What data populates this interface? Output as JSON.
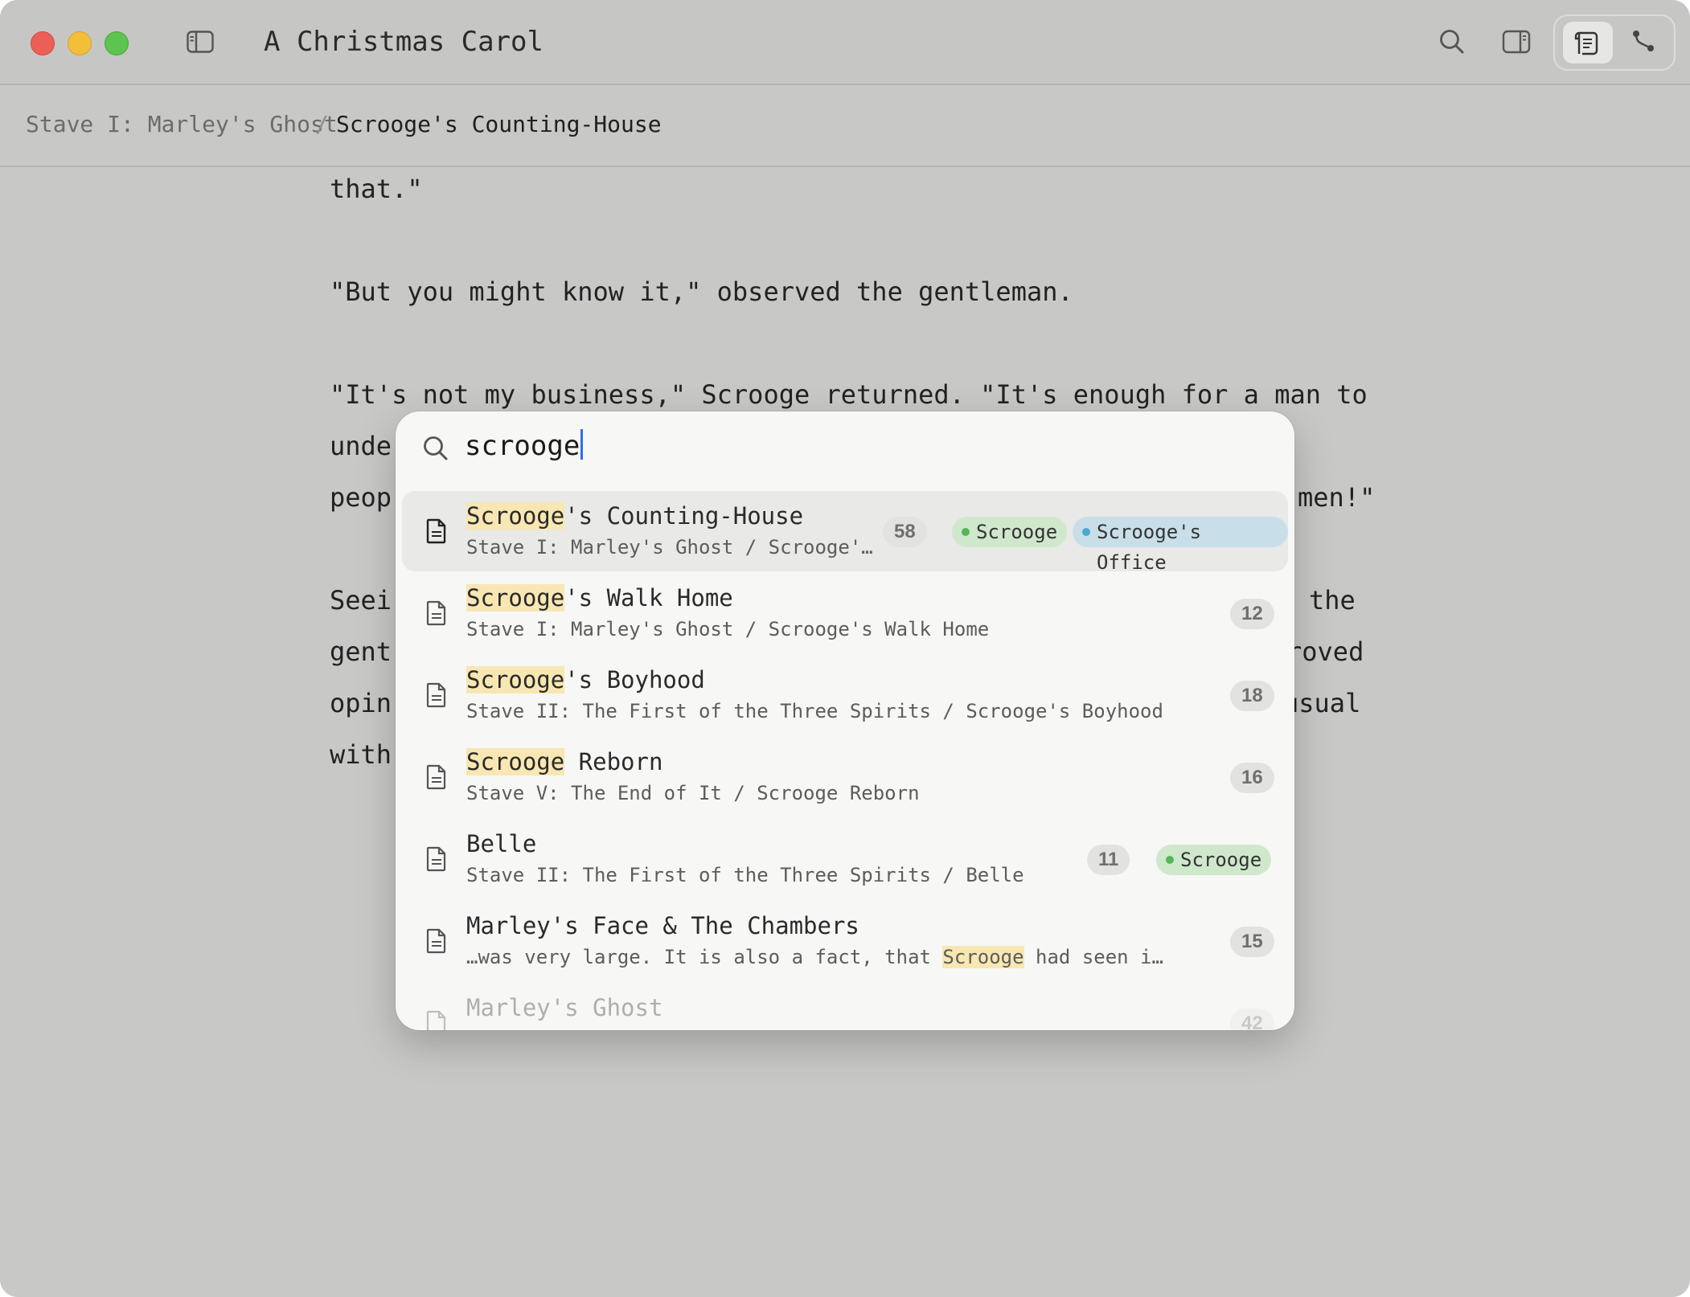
{
  "window": {
    "title": "A Christmas Carol"
  },
  "breadcrumb": {
    "parent": "Stave I: Marley's Ghost",
    "separator": "/",
    "current": "Scrooge's Counting-House"
  },
  "editor": {
    "lines": [
      "that.\"",
      "\"But you might know it,\" observed the gentleman.",
      "\"It's not my business,\" Scrooge returned. \"It's enough for a man to",
      "unde",
      "peop",
      "men!\"",
      "Seei",
      "the",
      "gent",
      "roved",
      "opin",
      "usual",
      "with"
    ]
  },
  "quick_open": {
    "query": "scrooge",
    "results": [
      {
        "title_hl": "Scrooge",
        "title_rest": "'s Counting-House",
        "subtitle": "Stave I: Marley's Ghost / Scrooge'…",
        "count": "58",
        "tags": [
          {
            "label": "Scrooge",
            "color": "#55b559"
          },
          {
            "label": "Scrooge's Office",
            "color": "#4aaad0"
          }
        ],
        "selected": true
      },
      {
        "title_hl": "Scrooge",
        "title_rest": "'s Walk Home",
        "subtitle": "Stave I: Marley's Ghost / Scrooge's Walk Home",
        "count": "12"
      },
      {
        "title_hl": "Scrooge",
        "title_rest": "'s Boyhood",
        "subtitle": "Stave II: The First of the Three Spirits / Scrooge's Boyhood",
        "count": "18"
      },
      {
        "title_hl": "Scrooge",
        "title_rest": " Reborn",
        "subtitle": "Stave V: The End of It / Scrooge Reborn",
        "count": "16"
      },
      {
        "title": "Belle",
        "subtitle": "Stave II: The First of the Three Spirits / Belle",
        "count": "11",
        "tags": [
          {
            "label": "Scrooge",
            "color": "#55b559"
          }
        ]
      },
      {
        "title": "Marley's Face & The Chambers",
        "subtitle_pre": "…was very large. It is also a fact, that ",
        "subtitle_hl": "Scrooge",
        "subtitle_post": " had seen i…",
        "count": "15"
      },
      {
        "title": "Marley's Ghost",
        "count": "42"
      }
    ]
  },
  "colors": {
    "highlight": "#f8e7b3",
    "caret": "#2d6df6"
  },
  "icons": [
    "close-button",
    "minimize-button",
    "maximize-button",
    "sidebar-icon",
    "search-icon",
    "inspector-icon",
    "outline-icon",
    "graph-icon",
    "document-icon"
  ]
}
